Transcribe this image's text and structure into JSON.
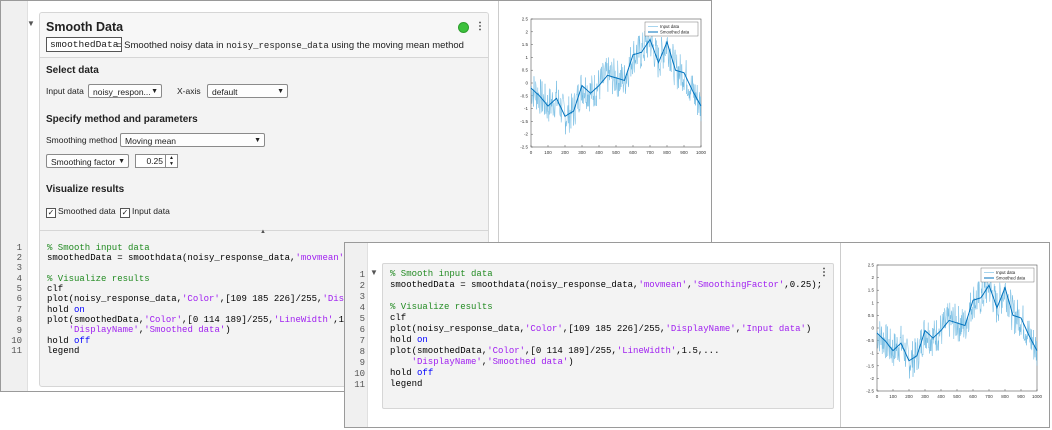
{
  "window1": {
    "line_numbers": [
      "1",
      "2",
      "3",
      "4",
      "5",
      "6",
      "7",
      "8",
      "9",
      "10",
      "11"
    ],
    "task": {
      "title": "Smooth Data",
      "output_variable": "smoothedData",
      "summary_prefix": "= Smoothed noisy data in",
      "summary_input": "noisy_response_data",
      "summary_suffix": "using the moving mean method",
      "select_data_heading": "Select data",
      "input_data_label": "Input data",
      "input_data_value": "noisy_respon...",
      "x_axis_label": "X-axis",
      "x_axis_value": "default",
      "method_heading": "Specify method and parameters",
      "smoothing_method_label": "Smoothing method",
      "smoothing_method_value": "Moving mean",
      "smoothing_factor_option": "Smoothing factor",
      "smoothing_factor_value": "0.25",
      "visualize_heading": "Visualize results",
      "smoothed_data_check": "Smoothed data",
      "input_data_check": "Input data"
    }
  },
  "window2": {
    "line_numbers": [
      "1",
      "2",
      "3",
      "4",
      "5",
      "6",
      "7",
      "8",
      "9",
      "10",
      "11"
    ]
  },
  "colors": {
    "input": "#6db9e2",
    "smoothed": "#0072bd",
    "status": "#3cc13c"
  },
  "chart_data": {
    "type": "line",
    "legend": [
      "Input data",
      "Smoothed data"
    ],
    "legend_placement": "top-right",
    "xlim": [
      0,
      1000
    ],
    "ylim": [
      -2.5,
      2.5
    ],
    "x_ticks": [
      "0",
      "100",
      "200",
      "300",
      "400",
      "500",
      "600",
      "700",
      "800",
      "900",
      "1000"
    ],
    "y_ticks": [
      "-2.5",
      "-2",
      "-1.5",
      "-1",
      "-0.5",
      "0",
      "0.5",
      "1",
      "1.5",
      "2",
      "2.5"
    ],
    "series": [
      {
        "name": "Smoothed data",
        "x": [
          0,
          50,
          100,
          150,
          200,
          250,
          300,
          350,
          400,
          450,
          500,
          550,
          600,
          650,
          700,
          750,
          800,
          850,
          900,
          950,
          1000
        ],
        "values": [
          -0.2,
          -0.5,
          -0.9,
          -0.6,
          -1.3,
          -1.1,
          -0.1,
          -0.4,
          -0.1,
          0.3,
          0.2,
          0.1,
          1.1,
          1.2,
          1.7,
          0.8,
          1.6,
          0.5,
          0.4,
          -0.3,
          -0.9
        ]
      },
      {
        "name": "Input data",
        "noise_amplitude": 0.75
      }
    ]
  }
}
